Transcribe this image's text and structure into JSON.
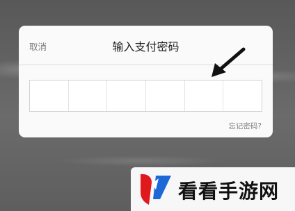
{
  "dialog": {
    "cancel_label": "取消",
    "title": "输入支付密码",
    "pin_cells": 6,
    "forgot_label": "忘记密码?"
  },
  "annotation": {
    "arrow_color": "#111111"
  },
  "watermark": {
    "text": "看看手游网",
    "logo_icon": "kk-logo-icon",
    "logo_colors": [
      "#e0191f",
      "#1e67d6"
    ]
  }
}
